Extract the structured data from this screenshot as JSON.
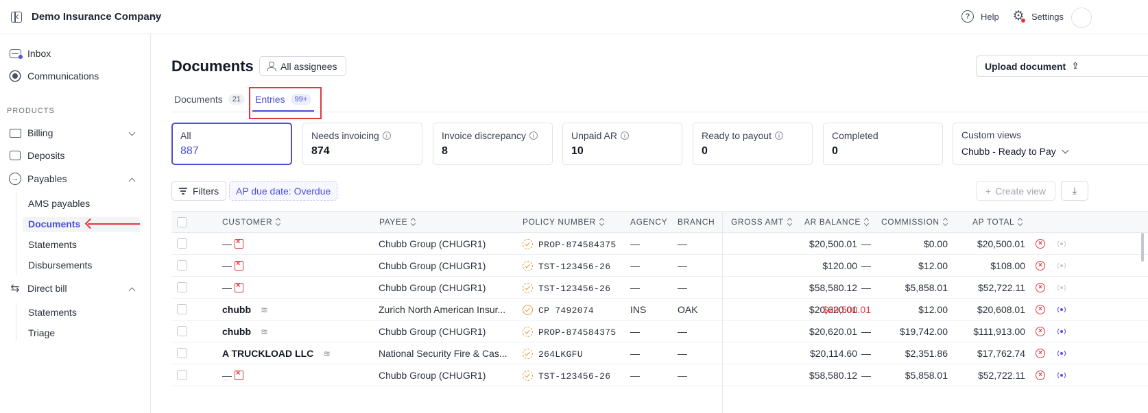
{
  "topbar": {
    "company": "Demo Insurance Company",
    "help_label": "Help",
    "settings_label": "Settings"
  },
  "sidebar": {
    "inbox": "Inbox",
    "communications": "Communications",
    "section_products": "PRODUCTS",
    "billing": "Billing",
    "deposits": "Deposits",
    "payables": "Payables",
    "payables_items": [
      "AMS payables",
      "Documents",
      "Statements",
      "Disbursements"
    ],
    "direct_bill": "Direct bill",
    "direct_bill_items": [
      "Statements",
      "Triage"
    ]
  },
  "page": {
    "title": "Documents",
    "assignees_label": "All assignees",
    "upload_label": "Upload document"
  },
  "tabs": [
    {
      "label": "Documents",
      "count": "21"
    },
    {
      "label": "Entries",
      "count": "99+"
    }
  ],
  "cards": [
    {
      "label": "All",
      "value": "887"
    },
    {
      "label": "Needs invoicing",
      "value": "874"
    },
    {
      "label": "Invoice discrepancy",
      "value": "8"
    },
    {
      "label": "Unpaid AR",
      "value": "10"
    },
    {
      "label": "Ready to payout",
      "value": "0"
    },
    {
      "label": "Completed",
      "value": "0"
    }
  ],
  "custom_views": {
    "label": "Custom views",
    "value": "Chubb - Ready to Pay"
  },
  "toolbar": {
    "filters_label": "Filters",
    "chip_label": "AP due date: Overdue",
    "create_view_label": "Create view"
  },
  "columns": {
    "customer": "CUSTOMER",
    "payee": "PAYEE",
    "policy": "POLICY NUMBER",
    "agency": "AGENCY",
    "branch": "BRANCH",
    "gross": "GROSS AMT",
    "ar": "AR BALANCE",
    "commission": "COMMISSION",
    "ap": "AP TOTAL"
  },
  "rows": [
    {
      "customer": "—",
      "payee": "Chubb Group (CHUGR1)",
      "policy": "PROP-874584375",
      "agency": "—",
      "branch": "—",
      "gross": "$20,500.01",
      "ar": "—",
      "commission": "$0.00",
      "ap": "$20,500.01"
    },
    {
      "customer": "—",
      "payee": "Chubb Group (CHUGR1)",
      "policy": "TST-123456-26",
      "agency": "—",
      "branch": "—",
      "gross": "$120.00",
      "ar": "—",
      "commission": "$12.00",
      "ap": "$108.00"
    },
    {
      "customer": "—",
      "payee": "Chubb Group (CHUGR1)",
      "policy": "TST-123456-26",
      "agency": "—",
      "branch": "—",
      "gross": "$58,580.12",
      "ar": "—",
      "commission": "$5,858.01",
      "ap": "$52,722.11"
    },
    {
      "customer": "chubb",
      "payee": "Zurich North American Insur...",
      "policy": "CP 7492074",
      "agency": "INS",
      "branch": "OAK",
      "gross": "$20,620.01",
      "ar": "$20,500.01",
      "commission": "$12.00",
      "ap": "$20,608.01"
    },
    {
      "customer": "chubb",
      "payee": "Chubb Group (CHUGR1)",
      "policy": "PROP-874584375",
      "agency": "—",
      "branch": "—",
      "gross": "$20,620.01",
      "ar": "—",
      "commission": "$19,742.00",
      "ap": "$111,913.00"
    },
    {
      "customer": "A TRUCKLOAD LLC",
      "payee": "National Security Fire & Cas...",
      "policy": "264LKGFU",
      "agency": "—",
      "branch": "—",
      "gross": "$20,114.60",
      "ar": "—",
      "commission": "$2,351.86",
      "ap": "$17,762.74"
    },
    {
      "customer": "—",
      "payee": "Chubb Group (CHUGR1)",
      "policy": "TST-123456-26",
      "agency": "—",
      "branch": "—",
      "gross": "$58,580.12",
      "ar": "—",
      "commission": "$5,858.01",
      "ap": "$52,722.11"
    }
  ]
}
